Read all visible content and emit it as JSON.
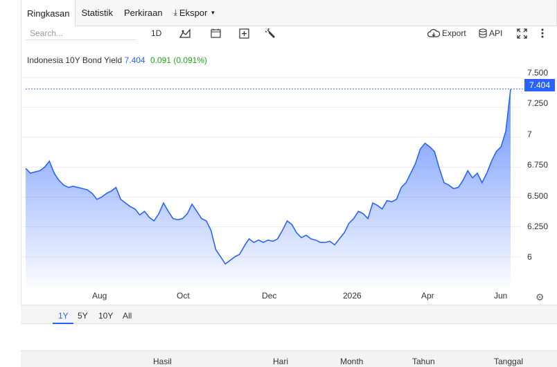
{
  "tabs": [
    {
      "label": "Ringkasan"
    },
    {
      "label": "Statistik"
    },
    {
      "label": "Perkiraan"
    },
    {
      "label": "Ekspor"
    }
  ],
  "toolbar": {
    "search_placeholder": "Search...",
    "interval": "1D",
    "export_label": "Export",
    "api_label": "API"
  },
  "legend": {
    "name": "Indonesia 10Y Bond Yield",
    "price": "7.404",
    "change": "0.091 (0.091%)"
  },
  "chart_data": {
    "type": "area",
    "series": [
      {
        "values": [
          6.74,
          6.7,
          6.71,
          6.72,
          6.75,
          6.8,
          6.7,
          6.64,
          6.6,
          6.58,
          6.59,
          6.58,
          6.57,
          6.56,
          6.53,
          6.48,
          6.5,
          6.53,
          6.55,
          6.58,
          6.48,
          6.45,
          6.42,
          6.4,
          6.35,
          6.38,
          6.33,
          6.3,
          6.36,
          6.45,
          6.38,
          6.32,
          6.31,
          6.32,
          6.36,
          6.44,
          6.38,
          6.32,
          6.3,
          6.22,
          6.06,
          6.0,
          5.94,
          5.97,
          6.0,
          6.02,
          6.09,
          6.15,
          6.12,
          6.14,
          6.12,
          6.14,
          6.13,
          6.15,
          6.22,
          6.3,
          6.27,
          6.2,
          6.16,
          6.18,
          6.15,
          6.14,
          6.12,
          6.12,
          6.13,
          6.1,
          6.15,
          6.2,
          6.28,
          6.32,
          6.38,
          6.36,
          6.32,
          6.45,
          6.43,
          6.4,
          6.47,
          6.46,
          6.48,
          6.58,
          6.62,
          6.7,
          6.78,
          6.9,
          6.95,
          6.92,
          6.88,
          6.74,
          6.62,
          6.6,
          6.57,
          6.58,
          6.64,
          6.72,
          6.66,
          6.7,
          6.62,
          6.7,
          6.8,
          6.88,
          6.92,
          7.05,
          7.4
        ]
      }
    ],
    "x_tick_labels": [
      "Aug",
      "Oct",
      "Dec",
      "2026",
      "Apr",
      "Jun"
    ],
    "y_tick_labels": [
      "7.500",
      "7.250",
      "7",
      "6.750",
      "6.500",
      "6.250",
      "6"
    ],
    "ylim": [
      5.75,
      7.58
    ],
    "last_value": 7.404,
    "line_color": "#2962ff",
    "grid": "horizontal"
  },
  "ranges": [
    "1Y",
    "5Y",
    "10Y",
    "All"
  ],
  "active_range": "1Y",
  "table_headers": [
    "Hasil",
    "Hari",
    "Month",
    "Tahun",
    "Tanggal"
  ]
}
